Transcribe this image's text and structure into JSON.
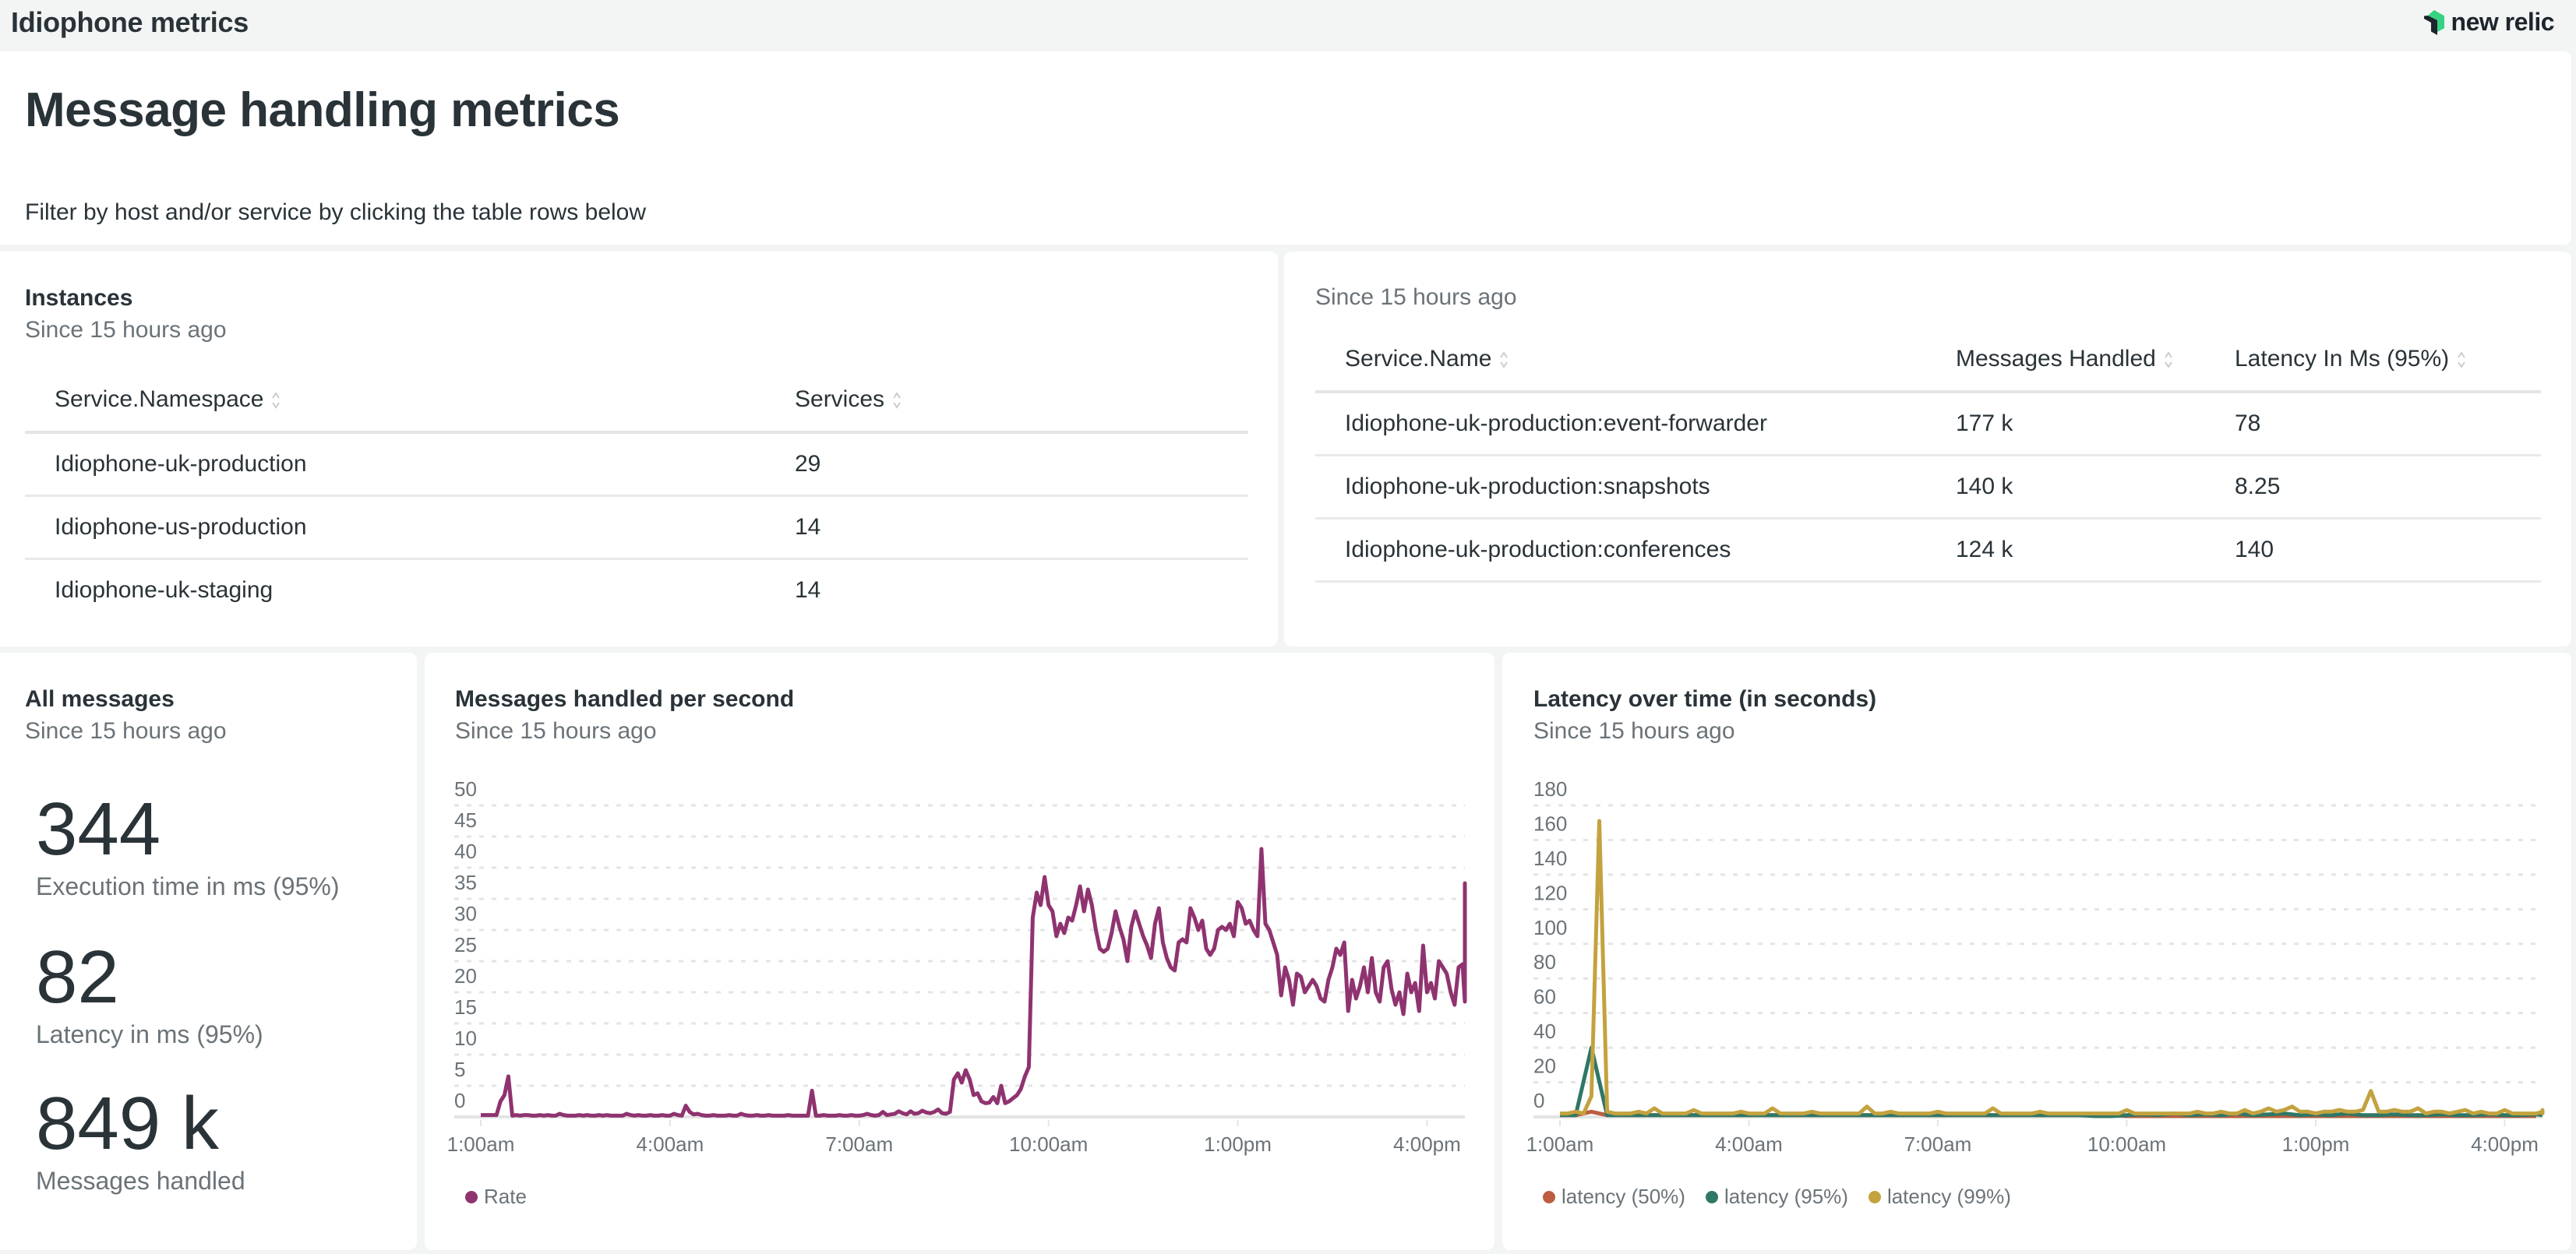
{
  "header": {
    "title": "Idiophone metrics",
    "logo_icon": "new-relic-logo-icon",
    "logo_text": "new relic"
  },
  "markdown": {
    "heading": "Message handling metrics",
    "text": "Filter by host and/or service by clicking the table rows below"
  },
  "instances": {
    "title": "Instances",
    "subtitle": "Since 15 hours ago",
    "columns": [
      "Service.Namespace",
      "Services"
    ],
    "rows": [
      [
        "Idiophone-uk-production",
        "29"
      ],
      [
        "Idiophone-us-production",
        "14"
      ],
      [
        "Idiophone-uk-staging",
        "14"
      ]
    ]
  },
  "services": {
    "subtitle": "Since 15 hours ago",
    "columns": [
      "Service.Name",
      "Messages Handled",
      "Latency In Ms (95%)"
    ],
    "rows": [
      [
        "Idiophone-uk-production:event-forwarder",
        "177 k",
        "78"
      ],
      [
        "Idiophone-uk-production:snapshots",
        "140 k",
        "8.25"
      ],
      [
        "Idiophone-uk-production:conferences",
        "124 k",
        "140"
      ]
    ]
  },
  "billboard": {
    "title": "All messages",
    "subtitle": "Since 15 hours ago",
    "metrics": [
      {
        "value": "344",
        "label": "Execution time in ms (95%)"
      },
      {
        "value": "82",
        "label": "Latency in ms (95%)"
      },
      {
        "value": "849 k",
        "label": "Messages handled"
      }
    ]
  },
  "chart_data": [
    {
      "type": "line",
      "title": "Messages handled per second",
      "subtitle": "Since 15 hours ago",
      "xlabel": "",
      "ylabel": "",
      "x_ticks": [
        "1:00am",
        "4:00am",
        "7:00am",
        "10:00am",
        "1:00pm",
        "4:00pm"
      ],
      "x_tick_hours": [
        1,
        4,
        7,
        10,
        13,
        16
      ],
      "x_range_hours": [
        0.58,
        16.6
      ],
      "y_ticks": [
        0,
        5,
        10,
        15,
        20,
        25,
        30,
        35,
        40,
        45,
        50
      ],
      "ylim": [
        0,
        50
      ],
      "grid": true,
      "legend_position": "bottom-left",
      "series": [
        {
          "name": "Rate",
          "color": "#8f3370",
          "start_hour": 1.0,
          "step_hours": 0.0625,
          "values": [
            0.3,
            0.3,
            0.3,
            0.3,
            0.3,
            2.5,
            3.5,
            6.5,
            0.2,
            0.3,
            0.2,
            0.3,
            0.3,
            0.2,
            0.2,
            0.3,
            0.2,
            0.3,
            0.2,
            0.2,
            0.5,
            0.3,
            0.2,
            0.2,
            0.2,
            0.3,
            0.2,
            0.3,
            0.2,
            0.2,
            0.3,
            0.2,
            0.3,
            0.2,
            0.2,
            0.2,
            0.2,
            0.5,
            0.3,
            0.2,
            0.3,
            0.2,
            0.2,
            0.3,
            0.2,
            0.2,
            0.3,
            0.2,
            0.2,
            0.5,
            0.3,
            0.2,
            1.8,
            0.8,
            0.4,
            0.5,
            0.3,
            0.2,
            0.2,
            0.3,
            0.2,
            0.2,
            0.2,
            0.3,
            0.2,
            0.2,
            0.5,
            0.3,
            0.2,
            0.2,
            0.3,
            0.2,
            0.2,
            0.3,
            0.2,
            0.2,
            0.2,
            0.2,
            0.3,
            0.2,
            0.2,
            0.2,
            0.2,
            0.2,
            4.2,
            0.2,
            0.2,
            0.3,
            0.2,
            0.2,
            0.2,
            0.3,
            0.2,
            0.2,
            0.3,
            0.2,
            0.2,
            0.3,
            0.5,
            0.3,
            0.2,
            0.3,
            0.8,
            0.3,
            0.4,
            0.5,
            0.9,
            0.6,
            0.4,
            0.9,
            0.5,
            0.6,
            1.0,
            0.7,
            0.6,
            0.8,
            1.2,
            0.6,
            0.5,
            0.8,
            6.0,
            7.0,
            5.5,
            7.5,
            6.0,
            3.5,
            3.8,
            2.5,
            2.2,
            2.3,
            3.2,
            2.2,
            5.0,
            2.2,
            2.5,
            3.0,
            3.5,
            4.5,
            6.5,
            8.0,
            32.0,
            36.0,
            34.0,
            38.5,
            34.0,
            33.0,
            29.0,
            31.0,
            29.5,
            32.0,
            31.5,
            34.0,
            37.0,
            33.0,
            36.5,
            34.0,
            30.0,
            27.0,
            26.5,
            27.0,
            29.5,
            33.0,
            30.5,
            28.5,
            25.0,
            30.5,
            33.0,
            31.0,
            29.0,
            27.5,
            25.5,
            31.0,
            33.5,
            28.0,
            25.5,
            24.0,
            23.5,
            28.0,
            28.5,
            28.0,
            33.5,
            32.0,
            30.0,
            31.5,
            27.0,
            26.0,
            27.0,
            30.0,
            30.5,
            30.0,
            31.0,
            29.0,
            34.5,
            33.5,
            31.0,
            31.5,
            30.0,
            29.0,
            43.0,
            31.0,
            30.0,
            28.0,
            26.0,
            19.5,
            24.0,
            22.0,
            18.0,
            23.0,
            22.5,
            20.0,
            21.0,
            22.0,
            21.0,
            19.0,
            18.5,
            22.0,
            24.0,
            27.0,
            26.0,
            28.0,
            17.0,
            22.0,
            19.0,
            21.0,
            24.0,
            20.0,
            25.5,
            20.0,
            18.5,
            24.0,
            25.0,
            20.5,
            18.0,
            20.0,
            16.5,
            23.0,
            20.0,
            21.5,
            17.0,
            27.5,
            20.0,
            21.5,
            19.0,
            25.0,
            24.0,
            23.0,
            20.0,
            18.0,
            24.0,
            24.5,
            18.5,
            22.5,
            25.0,
            19.0,
            23.5,
            20.0,
            24.5,
            18.5,
            23.0,
            24.0,
            24.5,
            21.0,
            23.0,
            29.0,
            27.0,
            30.5,
            28.5,
            27.5,
            27.5,
            33.5,
            24.5,
            23.0,
            27.0,
            31.5,
            25.0,
            19.5,
            26.0,
            28.5,
            37.5,
            34.0,
            30.0,
            25.5,
            31.5,
            26.0,
            25.0,
            29.0,
            34.5,
            26.5,
            22.5,
            26.5,
            30.5,
            27.0,
            23.0,
            21.0,
            25.0,
            22.0,
            28.0,
            21.0,
            22.5,
            19.5
          ]
        }
      ]
    },
    {
      "type": "line",
      "title": "Latency over time (in seconds)",
      "subtitle": "Since 15 hours ago",
      "xlabel": "",
      "ylabel": "",
      "x_ticks": [
        "1:00am",
        "4:00am",
        "7:00am",
        "10:00am",
        "1:00pm",
        "4:00pm"
      ],
      "x_tick_hours": [
        1,
        4,
        7,
        10,
        13,
        16
      ],
      "x_range_hours": [
        0.58,
        16.6
      ],
      "y_ticks": [
        0,
        20,
        40,
        60,
        80,
        100,
        120,
        140,
        160,
        180
      ],
      "ylim": [
        0,
        180
      ],
      "grid": true,
      "legend_position": "bottom-left",
      "series": [
        {
          "name": "latency (50%)",
          "color": "#bc5d3f",
          "start_hour": 1.0,
          "step_hours": 0.25,
          "values": [
            1,
            1,
            3,
            1,
            1,
            1,
            1,
            1,
            1,
            1,
            1,
            1,
            1,
            1,
            1,
            1,
            1,
            1,
            1,
            1,
            1,
            1,
            1,
            1,
            1,
            1,
            1,
            1,
            1,
            1,
            1,
            1,
            1,
            1,
            1,
            1,
            0.5,
            0.5,
            0.5,
            0.5,
            0.5,
            0.5,
            0.5,
            0.5,
            0.5,
            0.5,
            0.5,
            0.5,
            0.5,
            0.5,
            0.5,
            0.5,
            0.5,
            0.5,
            0.5,
            0.5,
            0.5,
            0.5,
            0.5,
            0.5,
            0.5,
            0.5,
            0.5
          ]
        },
        {
          "name": "latency (95%)",
          "color": "#2f7766",
          "start_hour": 1.0,
          "step_hours": 0.25,
          "values": [
            1,
            1,
            40,
            1,
            1,
            1,
            1,
            1,
            1,
            1,
            1,
            1,
            1,
            1,
            1,
            1,
            1,
            1,
            1,
            1,
            1,
            1,
            1,
            1,
            1,
            1,
            1,
            1,
            1,
            1,
            1,
            1,
            1,
            1,
            0.5,
            0.5,
            1,
            1.5,
            1,
            2,
            1,
            1.5,
            1,
            2,
            1,
            1.5,
            2,
            1,
            1.5,
            1,
            2,
            1,
            1,
            1.5,
            1,
            1,
            1.5,
            1,
            1,
            1.5,
            1,
            1,
            1.5,
            1
          ]
        },
        {
          "name": "latency (99%)",
          "color": "#c3a23f",
          "start_hour": 1.0,
          "step_hours": 0.125,
          "values": [
            2,
            2,
            3,
            2,
            12,
            171,
            3,
            2,
            2,
            2,
            3,
            2,
            5,
            2,
            2,
            2,
            2,
            4,
            2,
            2,
            2,
            2,
            2,
            3,
            2,
            2,
            2,
            5,
            2,
            2,
            2,
            2,
            3,
            2,
            2,
            2,
            2,
            2,
            2,
            6,
            2,
            2,
            3,
            2,
            2,
            2,
            2,
            2,
            3,
            2,
            2,
            2,
            2,
            2,
            2,
            5,
            2,
            2,
            2,
            2,
            2,
            3,
            2,
            2,
            2,
            2,
            2,
            2,
            2,
            2,
            2,
            2,
            4,
            2,
            2,
            2,
            2,
            2,
            2,
            2,
            2,
            3,
            2,
            2,
            3,
            2,
            2,
            4,
            2,
            3,
            5,
            3,
            4,
            6,
            3,
            3,
            2,
            3,
            3,
            4,
            3,
            3,
            4,
            15,
            3,
            3,
            4,
            3,
            3,
            5,
            2,
            3,
            3,
            2,
            3,
            4,
            2,
            3,
            2,
            2,
            4,
            2,
            2,
            2,
            2,
            3,
            2,
            3,
            2,
            2,
            2,
            4,
            2,
            3,
            2,
            2,
            2,
            3,
            2,
            2,
            2,
            3,
            2,
            2,
            4,
            3,
            2,
            2,
            3
          ]
        }
      ]
    }
  ]
}
